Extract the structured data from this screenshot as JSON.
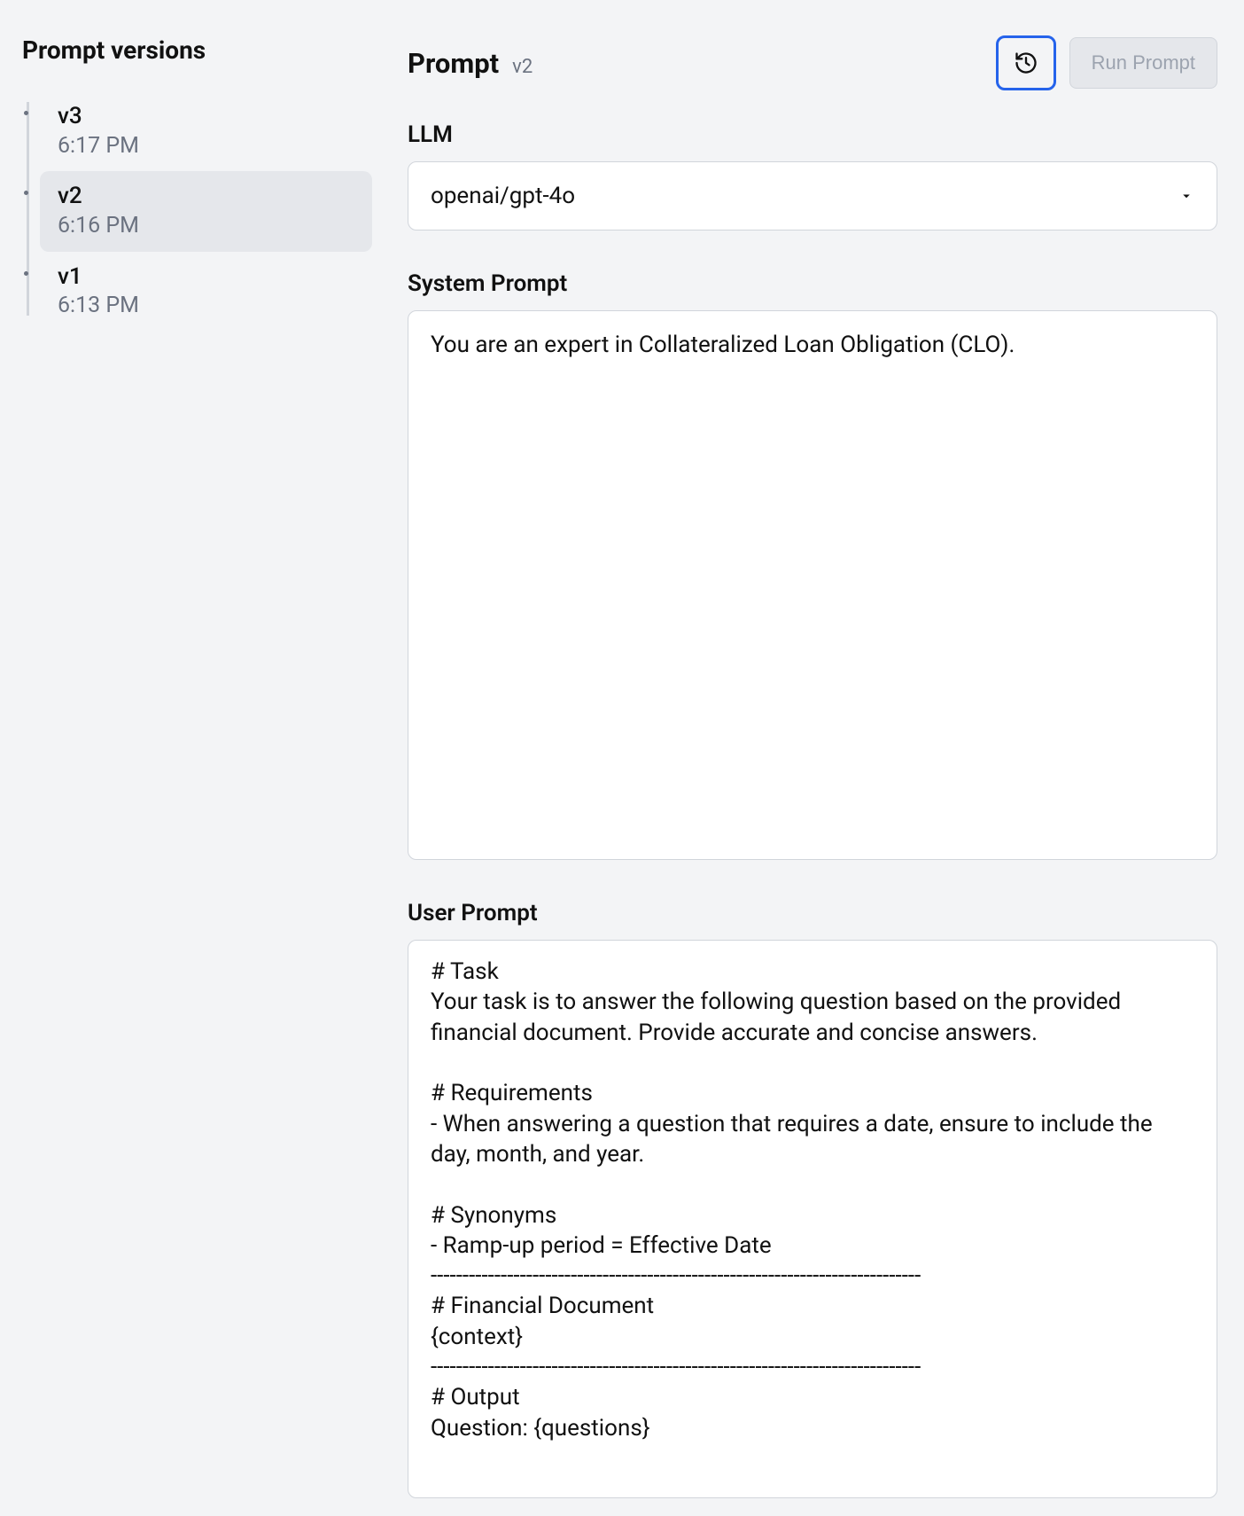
{
  "sidebar": {
    "title": "Prompt versions",
    "versions": [
      {
        "name": "v3",
        "time": "6:17 PM",
        "active": false
      },
      {
        "name": "v2",
        "time": "6:16 PM",
        "active": true
      },
      {
        "name": "v1",
        "time": "6:13 PM",
        "active": false
      }
    ]
  },
  "header": {
    "title": "Prompt",
    "version_badge": "v2",
    "run_label": "Run Prompt"
  },
  "llm": {
    "label": "LLM",
    "value": "openai/gpt-4o"
  },
  "system_prompt": {
    "label": "System Prompt",
    "value": "You are an expert in Collateralized Loan Obligation (CLO)."
  },
  "user_prompt": {
    "label": "User Prompt",
    "value": "# Task\nYour task is to answer the following question based on the provided financial document. Provide accurate and concise answers.\n\n# Requirements\n- When answering a question that requires a date, ensure to include the day, month, and year.\n\n# Synonyms\n- Ramp-up period = Effective Date\n-----------------------------------------------------------------------------\n# Financial Document\n{context}\n-----------------------------------------------------------------------------\n# Output\nQuestion: {questions}"
  }
}
